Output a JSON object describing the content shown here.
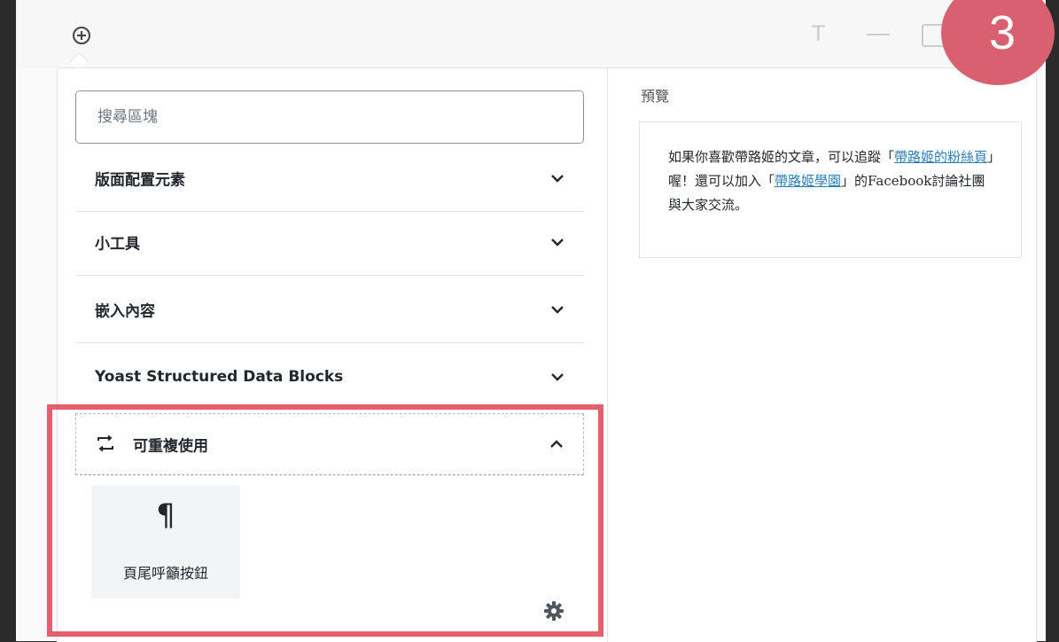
{
  "toolbar": {
    "add_icon": "circle-plus-icon",
    "text_icon": "T",
    "minimize_icon": "minus-icon",
    "window_icon": "window-icon"
  },
  "search": {
    "placeholder": "搜尋區塊",
    "value": ""
  },
  "categories": [
    {
      "label": "版面配置元素",
      "expanded": false
    },
    {
      "label": "小工具",
      "expanded": false
    },
    {
      "label": "嵌入內容",
      "expanded": false
    },
    {
      "label": "Yoast Structured Data Blocks",
      "expanded": false
    }
  ],
  "reusable": {
    "label": "可重複使用",
    "expanded": true,
    "icon": "reusable-block-icon",
    "block": {
      "icon": "¶",
      "label": "頁尾呼籲按鈕"
    },
    "manage_icon": "gear-icon"
  },
  "preview": {
    "title": "預覽",
    "text_1": "如果你喜歡帶路姬的文章，可以追蹤「",
    "link_1": "帶路姬的粉絲頁",
    "text_2": "」喔！還可以加入「",
    "link_2": "帶路姬學園",
    "text_3": "」的Facebook討論社團與大家交流。"
  },
  "badge": {
    "number": "3"
  },
  "colors": {
    "highlight": "#e4606e",
    "badge": "#d9606f",
    "link": "#2d7fb8"
  }
}
